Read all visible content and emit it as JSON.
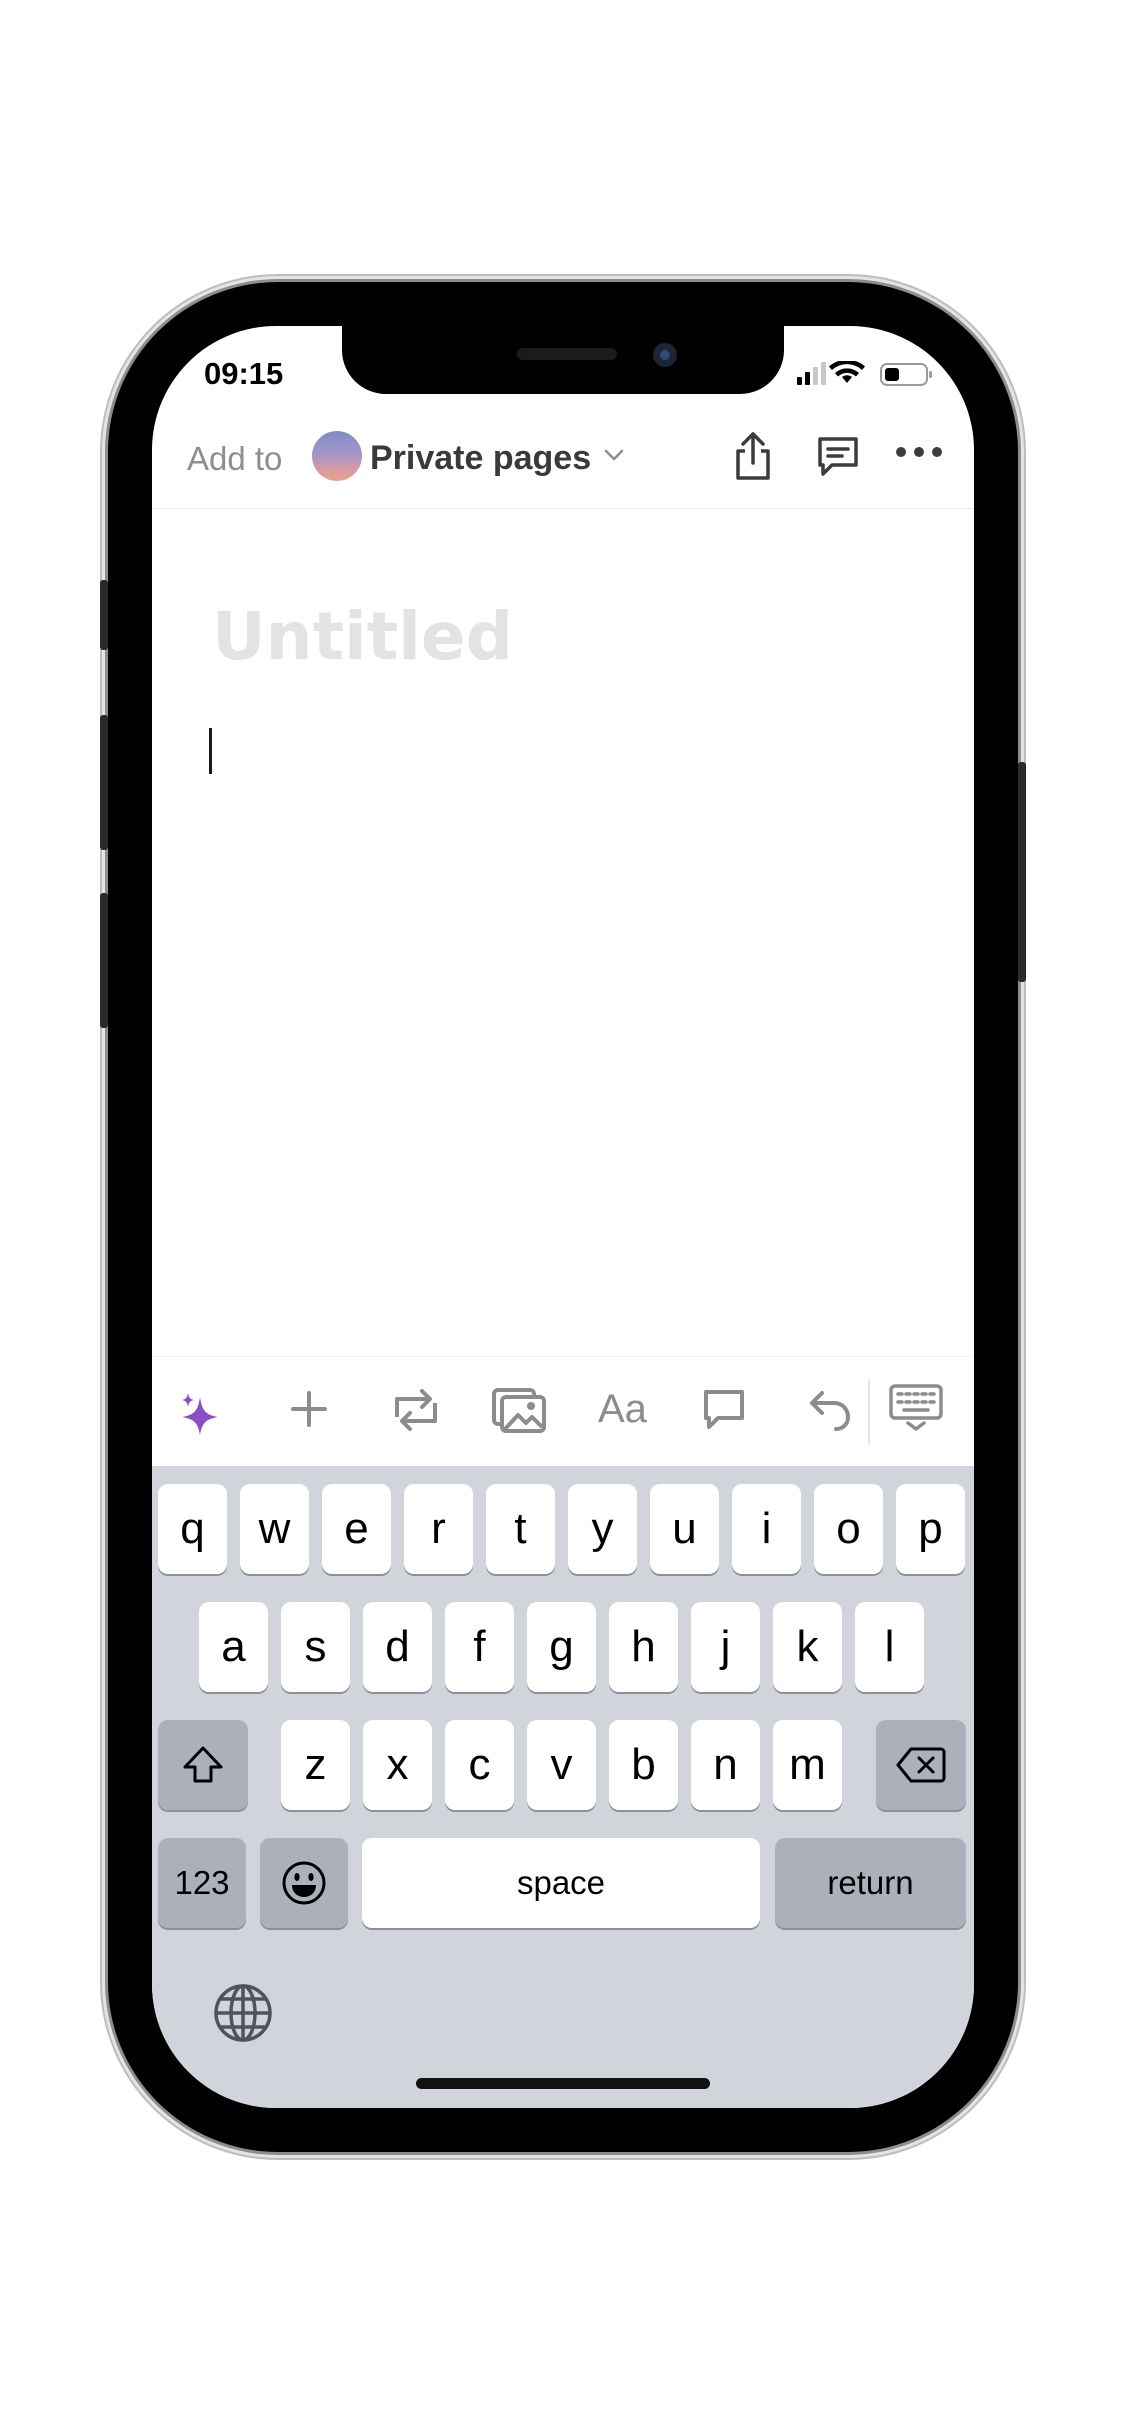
{
  "status_bar": {
    "time": "09:15"
  },
  "nav": {
    "add_to_label": "Add to",
    "workspace_name": "Private pages",
    "icons": [
      "share-icon",
      "comment-icon",
      "more-icon"
    ]
  },
  "page": {
    "title_placeholder": "Untitled"
  },
  "toolbar": {
    "items": [
      "ai-sparkle-icon",
      "plus-icon",
      "turn-into-icon",
      "image-icon",
      "text-style-icon",
      "comment-icon",
      "undo-icon",
      "hide-keyboard-icon"
    ],
    "text_style_label": "Aa"
  },
  "keyboard": {
    "row1": [
      "q",
      "w",
      "e",
      "r",
      "t",
      "y",
      "u",
      "i",
      "o",
      "p"
    ],
    "row2": [
      "a",
      "s",
      "d",
      "f",
      "g",
      "h",
      "j",
      "k",
      "l"
    ],
    "row3": [
      "z",
      "x",
      "c",
      "v",
      "b",
      "n",
      "m"
    ],
    "numbers_label": "123",
    "space_label": "space",
    "return_label": "return"
  },
  "colors": {
    "accent_ai": "#8a4fc7",
    "keyboard_bg": "#d1d4db",
    "title_placeholder": "#e3e3e3"
  }
}
